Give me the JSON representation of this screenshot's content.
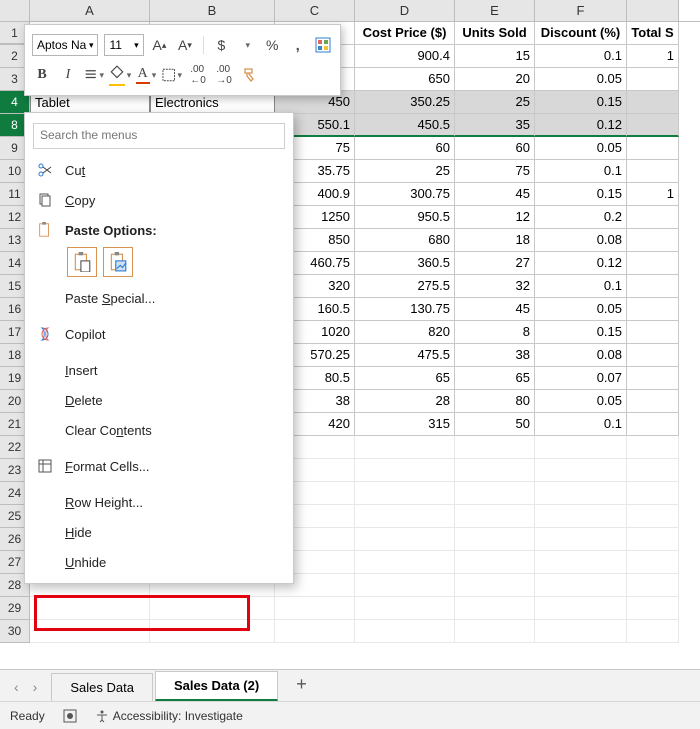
{
  "columns": [
    "A",
    "B",
    "C",
    "D",
    "E",
    "F"
  ],
  "headers": {
    "D": "Cost Price ($)",
    "E": "Units Sold",
    "F": "Discount (%)",
    "G": "Total S"
  },
  "partial_row4": {
    "A": "Tablet",
    "B": "Electronics"
  },
  "rows": {
    "2": {
      "D": "900.4",
      "E": "15",
      "F": "0.1",
      "G": "1"
    },
    "3": {
      "D": "650",
      "E": "20",
      "F": "0.05"
    },
    "4": {
      "C": "450",
      "D": "350.25",
      "E": "25",
      "F": "0.15"
    },
    "8": {
      "C": "550.1",
      "D": "450.5",
      "E": "35",
      "F": "0.12"
    },
    "9": {
      "C": "75",
      "D": "60",
      "E": "60",
      "F": "0.05"
    },
    "10": {
      "C": "35.75",
      "D": "25",
      "E": "75",
      "F": "0.1"
    },
    "11": {
      "C": "400.9",
      "D": "300.75",
      "E": "45",
      "F": "0.15",
      "G": "1"
    },
    "12": {
      "C": "1250",
      "D": "950.5",
      "E": "12",
      "F": "0.2"
    },
    "13": {
      "C": "850",
      "D": "680",
      "E": "18",
      "F": "0.08"
    },
    "14": {
      "C": "460.75",
      "D": "360.5",
      "E": "27",
      "F": "0.12"
    },
    "15": {
      "C": "320",
      "D": "275.5",
      "E": "32",
      "F": "0.1"
    },
    "16": {
      "C": "160.5",
      "D": "130.75",
      "E": "45",
      "F": "0.05"
    },
    "17": {
      "C": "1020",
      "D": "820",
      "E": "8",
      "F": "0.15"
    },
    "18": {
      "C": "570.25",
      "D": "475.5",
      "E": "38",
      "F": "0.08"
    },
    "19": {
      "C": "80.5",
      "D": "65",
      "E": "65",
      "F": "0.07"
    },
    "20": {
      "C": "38",
      "D": "28",
      "E": "80",
      "F": "0.05"
    },
    "21": {
      "C": "420",
      "D": "315",
      "E": "50",
      "F": "0.1"
    }
  },
  "empty_rows": [
    "22",
    "23",
    "24",
    "25",
    "26",
    "27",
    "28",
    "29",
    "30"
  ],
  "mini": {
    "font": "Aptos Na",
    "size": "11"
  },
  "context": {
    "search_placeholder": "Search the menus",
    "cut": "Cut",
    "copy": "Copy",
    "paste_options": "Paste Options:",
    "paste_special": "Paste Special...",
    "copilot": "Copilot",
    "insert": "Insert",
    "delete": "Delete",
    "clear": "Clear Contents",
    "format_cells": "Format Cells...",
    "row_height": "Row Height...",
    "hide": "Hide",
    "unhide": "Unhide"
  },
  "tabs": {
    "t1": "Sales Data",
    "t2": "Sales Data (2)"
  },
  "status": {
    "ready": "Ready",
    "acc": "Accessibility: Investigate"
  }
}
